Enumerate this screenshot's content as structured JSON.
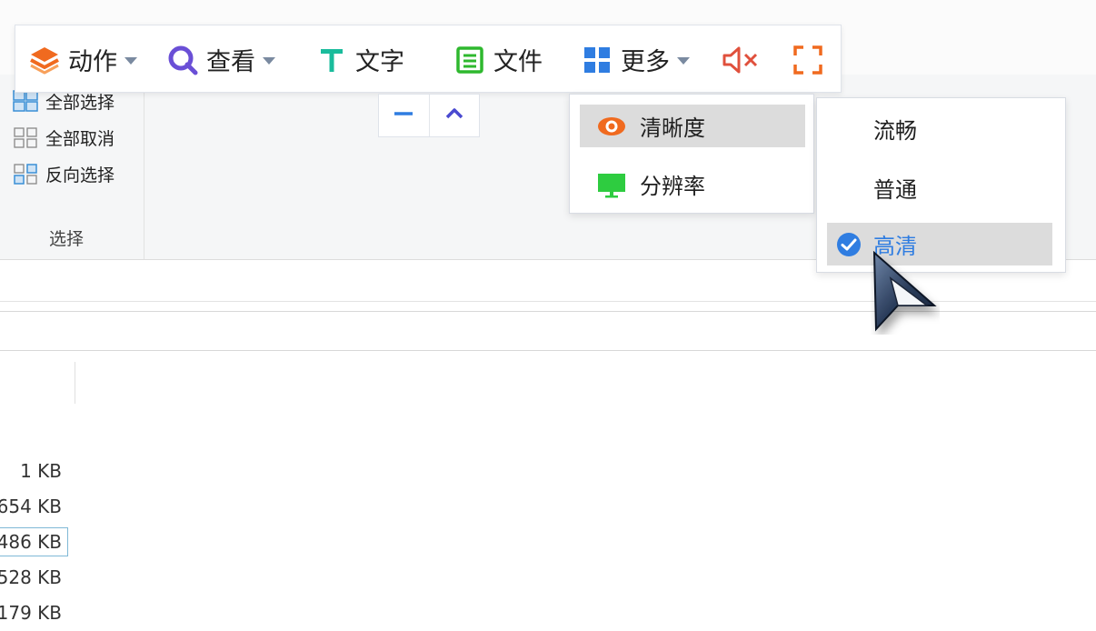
{
  "toolbar": {
    "action": {
      "label": "动作",
      "icon": "layers-icon",
      "color": "#f06a1f"
    },
    "view": {
      "label": "查看",
      "icon": "search-icon",
      "color": "#6a4fd6"
    },
    "text": {
      "label": "文字",
      "icon": "text-icon",
      "color": "#1abc9c"
    },
    "file": {
      "label": "文件",
      "icon": "file-icon",
      "color": "#2eb82e"
    },
    "more": {
      "label": "更多",
      "icon": "grid-icon",
      "color": "#2f7de1"
    },
    "mute": {
      "icon": "speaker-muted-icon",
      "color": "#e0503c"
    },
    "fullscreen": {
      "icon": "fullscreen-icon",
      "color": "#f06a1f"
    }
  },
  "zoom": {
    "minus_icon": "minus-icon",
    "up_icon": "chevron-up-icon"
  },
  "quality_menu": {
    "items": [
      {
        "label": "清晰度",
        "icon": "eye-icon",
        "active": true
      },
      {
        "label": "分辨率",
        "icon": "monitor-icon",
        "active": false
      }
    ]
  },
  "quality_submenu": {
    "items": [
      {
        "label": "流畅",
        "checked": false
      },
      {
        "label": "普通",
        "checked": false
      },
      {
        "label": "高清",
        "checked": true
      }
    ],
    "check_color": "#2f7de1"
  },
  "explorer": {
    "select_group": {
      "items": [
        "全部选择",
        "全部取消",
        "反向选择"
      ],
      "group_label": "选择"
    },
    "file_sizes": [
      "1 KB",
      "654 KB",
      "486 KB",
      "528 KB",
      "179 KB"
    ],
    "selected_index": 2
  }
}
